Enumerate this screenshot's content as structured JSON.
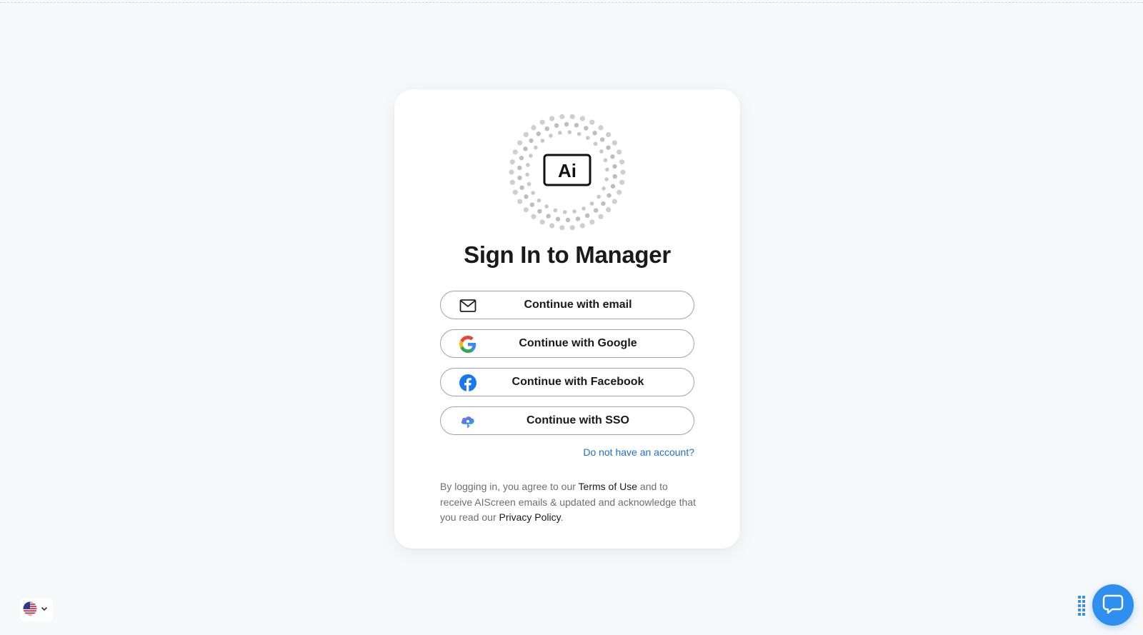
{
  "card": {
    "logo_text": "Ai",
    "title": "Sign In to Manager",
    "buttons": {
      "email": "Continue with email",
      "google": "Continue with Google",
      "facebook": "Continue with Facebook",
      "sso": "Continue with SSO"
    },
    "signup_link": "Do not have an account?",
    "legal": {
      "part1": "By logging in, you agree to our ",
      "terms": "Terms of Use",
      "part2": " and to receive AIScreen emails & updated and acknowledge that you read our ",
      "privacy": "Privacy Policy",
      "part3": "."
    }
  },
  "footer": {
    "language_flag": "us-flag-icon",
    "chat_icon": "chat-bubble-icon"
  },
  "colors": {
    "background": "#f7f8fa",
    "link": "#1f6fd1",
    "chat_button": "#2e8ff0",
    "facebook": "#1877f2"
  }
}
